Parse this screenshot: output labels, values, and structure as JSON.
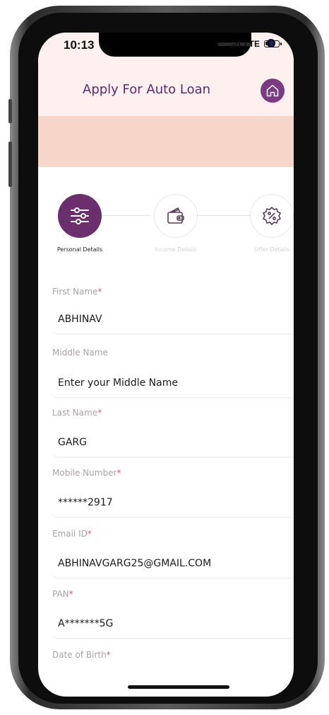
{
  "status_bar": {
    "time": "10:13",
    "signal": "LTE"
  },
  "header": {
    "title": "Apply For Auto Loan"
  },
  "steps": [
    {
      "label": "Personal Details",
      "state": "active",
      "icon": "sliders-icon"
    },
    {
      "label": "Income Details",
      "state": "inactive",
      "icon": "wallet-icon"
    },
    {
      "label": "Offer Details",
      "state": "inactive",
      "icon": "percent-badge-icon"
    }
  ],
  "form": {
    "fields": [
      {
        "label": "First Name",
        "required": "*",
        "value": "ABHINAV"
      },
      {
        "label": "Middle Name",
        "required": "",
        "value": "",
        "placeholder": "Enter your Middle Name"
      },
      {
        "label": "Last Name",
        "required": "*",
        "value": "GARG"
      },
      {
        "label": "Mobile Number",
        "required": "*",
        "value": "******2917"
      },
      {
        "label": "Email ID",
        "required": "*",
        "value": "ABHINAVGARG25@GMAIL.COM"
      },
      {
        "label": "PAN",
        "required": "*",
        "value": "A*******5G"
      },
      {
        "label": "Date of Birth",
        "required": "*"
      }
    ]
  },
  "colors": {
    "accent": "#6b2f6e",
    "header_bg": "#fdf0ee",
    "banner_bg": "#f6d6c8",
    "title": "#5a2a70"
  }
}
